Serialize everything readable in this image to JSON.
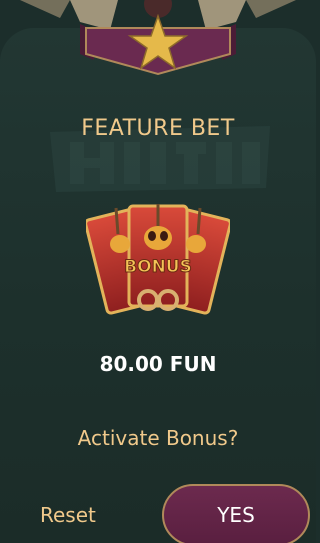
{
  "dialog": {
    "title": "FEATURE BET",
    "amount": "80.00 FUN",
    "question": "Activate Bonus?"
  },
  "cards": {
    "label": "BONUS"
  },
  "actions": {
    "reset_label": "Reset",
    "yes_label": "YES"
  },
  "colors": {
    "background": "#1c2e2b",
    "accent_gold": "#f0c98b",
    "button_purple": "#5e2244",
    "button_border": "#b0895a",
    "banner_purple": "#6a2a50"
  },
  "icons": {
    "banner": "star-icon",
    "background": "game-logo-watermark",
    "feature": "bonus-cards-icon"
  }
}
